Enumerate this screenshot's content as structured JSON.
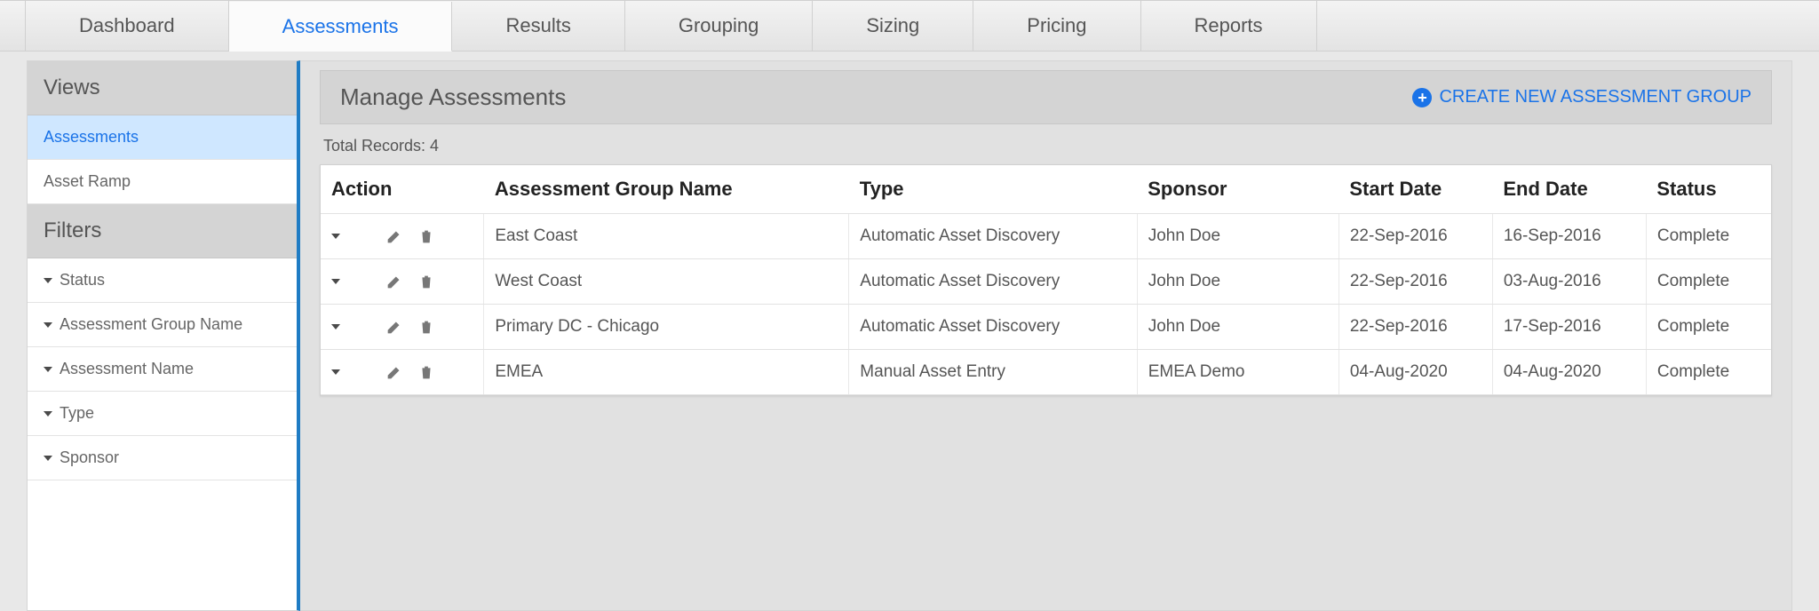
{
  "topnav": {
    "tabs": [
      {
        "label": "Dashboard",
        "active": false
      },
      {
        "label": "Assessments",
        "active": true
      },
      {
        "label": "Results",
        "active": false
      },
      {
        "label": "Grouping",
        "active": false
      },
      {
        "label": "Sizing",
        "active": false
      },
      {
        "label": "Pricing",
        "active": false
      },
      {
        "label": "Reports",
        "active": false
      }
    ]
  },
  "sidebar": {
    "views_header": "Views",
    "views": [
      {
        "label": "Assessments",
        "active": true
      },
      {
        "label": "Asset Ramp",
        "active": false
      }
    ],
    "filters_header": "Filters",
    "filters": [
      {
        "label": "Status"
      },
      {
        "label": "Assessment Group Name"
      },
      {
        "label": "Assessment Name"
      },
      {
        "label": "Type"
      },
      {
        "label": "Sponsor"
      }
    ]
  },
  "content": {
    "page_title": "Manage Assessments",
    "create_label": "CREATE NEW ASSESSMENT GROUP",
    "total_records_label": "Total Records: 4",
    "columns": {
      "action": "Action",
      "name": "Assessment Group Name",
      "type": "Type",
      "sponsor": "Sponsor",
      "start": "Start Date",
      "end": "End Date",
      "status": "Status"
    },
    "rows": [
      {
        "name": "East Coast",
        "type": "Automatic Asset Discovery",
        "sponsor": "John Doe",
        "start": "22-Sep-2016",
        "end": "16-Sep-2016",
        "status": "Complete"
      },
      {
        "name": "West Coast",
        "type": "Automatic Asset Discovery",
        "sponsor": "John Doe",
        "start": "22-Sep-2016",
        "end": "03-Aug-2016",
        "status": "Complete"
      },
      {
        "name": "Primary DC - Chicago",
        "type": "Automatic Asset Discovery",
        "sponsor": "John Doe",
        "start": "22-Sep-2016",
        "end": "17-Sep-2016",
        "status": "Complete"
      },
      {
        "name": "EMEA",
        "type": "Manual Asset Entry",
        "sponsor": "EMEA Demo",
        "start": "04-Aug-2020",
        "end": "04-Aug-2020",
        "status": "Complete"
      }
    ]
  }
}
